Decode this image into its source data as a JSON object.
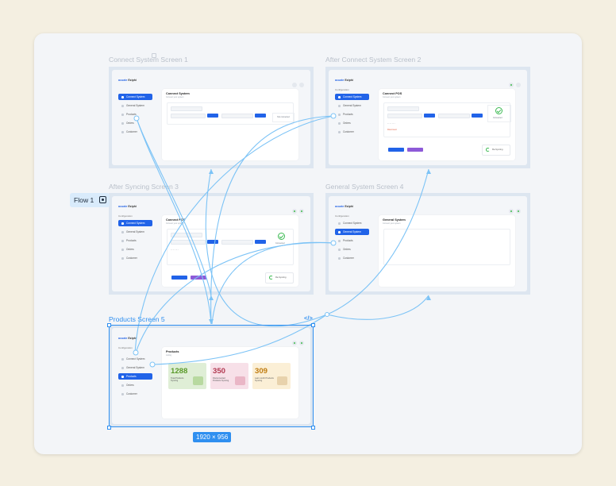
{
  "flow": {
    "label": "Flow 1"
  },
  "selection": {
    "dimensions": "1920 × 956",
    "code_glyph": "</>"
  },
  "app": {
    "logo_brand": "acuate",
    "logo_name": "Eziphi",
    "config_label": "Configuration"
  },
  "nav_items": [
    "Connect System",
    "General System",
    "Products",
    "Orders",
    "Customer"
  ],
  "screens": {
    "s1": {
      "title": "Connect System Screen 1",
      "card_title": "Connect System",
      "card_sub": "Connect your system",
      "box_text": "Not connected"
    },
    "s2": {
      "title": "After Connect System Screen 2",
      "card_title": "Connect POS",
      "card_sub": "Connect your system",
      "check_label": "Connected",
      "btn1": "Enable Sync",
      "btn2": "Sync Now",
      "sync_text": "Re-Syncing",
      "red": "Disconnect"
    },
    "s3": {
      "title": "After Syncing Screen 3",
      "card_title": "Connect POS",
      "card_sub": "Connect your system",
      "check_label": "Connected",
      "sync_text": "Re-Syncing"
    },
    "s4": {
      "title": "General System Screen 4",
      "card_title": "General System",
      "card_sub": "Connect your system"
    },
    "s5": {
      "title": "Products Screen 5",
      "card_title": "Products",
      "card_sub": "Listing"
    }
  },
  "products": [
    {
      "number": "1288",
      "label": "Total Products Syncing",
      "color": "#5a9a2a",
      "bg": "#dfeed6"
    },
    {
      "number": "350",
      "label": "Disconnected Products Syncing",
      "color": "#b23a52",
      "bg": "#f7e0e8"
    },
    {
      "number": "309",
      "label": "Last month Products Syncing",
      "color": "#c07d12",
      "bg": "#fbefd6"
    }
  ]
}
